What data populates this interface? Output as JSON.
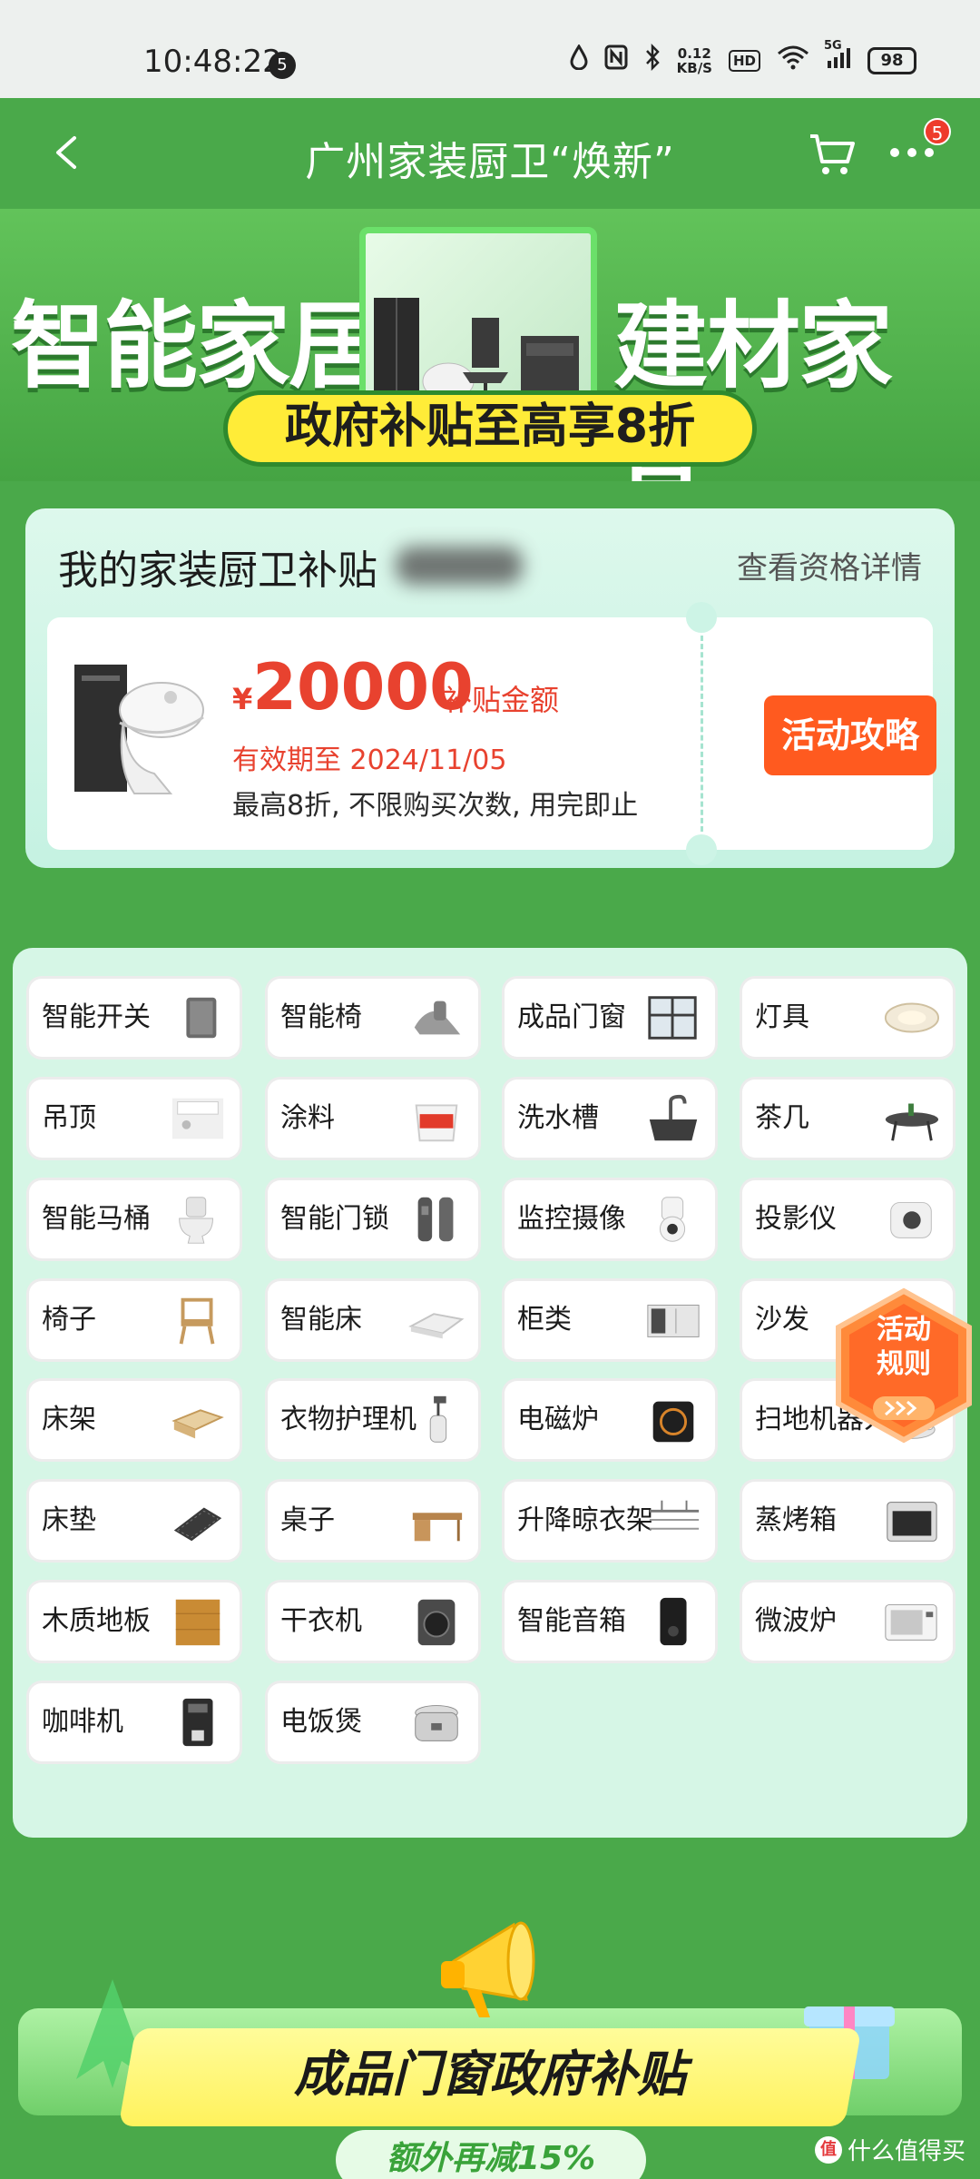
{
  "status_bar": {
    "time": "10:48:22",
    "notification_count": "5",
    "net_speed_value": "0.12",
    "net_speed_unit": "KB/S",
    "hd": "HD",
    "network": "5G",
    "battery": "98"
  },
  "nav": {
    "title": "广州家装厨卫“焕新”",
    "more_badge": "5"
  },
  "banner": {
    "left_text": "智能家居",
    "right_text": "建材家具",
    "pill_text": "政府补贴至高享8折"
  },
  "subsidy": {
    "title": "我的家装厨卫补贴",
    "details_link": "查看资格详情",
    "currency": "¥",
    "amount": "20000",
    "amount_label": "补贴金额",
    "valid_until": "有效期至 2024/11/05",
    "rule": "最高8折, 不限购买次数, 用完即止",
    "button": "活动攻略"
  },
  "categories": [
    {
      "label": "智能开关",
      "icon": "switch-icon"
    },
    {
      "label": "智能椅",
      "icon": "massage-chair-icon"
    },
    {
      "label": "成品门窗",
      "icon": "window-icon"
    },
    {
      "label": "灯具",
      "icon": "ceiling-lamp-icon"
    },
    {
      "label": "吊顶",
      "icon": "ceiling-icon"
    },
    {
      "label": "涂料",
      "icon": "paint-bucket-icon"
    },
    {
      "label": "洗水槽",
      "icon": "sink-icon"
    },
    {
      "label": "茶几",
      "icon": "coffee-table-icon"
    },
    {
      "label": "智能马桶",
      "icon": "toilet-icon"
    },
    {
      "label": "智能门锁",
      "icon": "door-lock-icon"
    },
    {
      "label": "监控摄像",
      "icon": "camera-icon"
    },
    {
      "label": "投影仪",
      "icon": "projector-icon"
    },
    {
      "label": "椅子",
      "icon": "chair-icon"
    },
    {
      "label": "智能床",
      "icon": "bed-icon"
    },
    {
      "label": "柜类",
      "icon": "cabinet-icon"
    },
    {
      "label": "沙发",
      "icon": "sofa-icon"
    },
    {
      "label": "床架",
      "icon": "bed-frame-icon"
    },
    {
      "label": "衣物护理机",
      "icon": "garment-steamer-icon"
    },
    {
      "label": "电磁炉",
      "icon": "induction-cooker-icon"
    },
    {
      "label": "扫地机器人",
      "icon": "robot-vacuum-icon"
    },
    {
      "label": "床垫",
      "icon": "mattress-icon"
    },
    {
      "label": "桌子",
      "icon": "desk-icon"
    },
    {
      "label": "升降晾衣架",
      "icon": "drying-rack-icon"
    },
    {
      "label": "蒸烤箱",
      "icon": "steam-oven-icon"
    },
    {
      "label": "木质地板",
      "icon": "wood-floor-icon"
    },
    {
      "label": "干衣机",
      "icon": "dryer-icon"
    },
    {
      "label": "智能音箱",
      "icon": "speaker-icon"
    },
    {
      "label": "微波炉",
      "icon": "microwave-icon"
    },
    {
      "label": "咖啡机",
      "icon": "coffee-machine-icon"
    },
    {
      "label": "电饭煲",
      "icon": "rice-cooker-icon"
    }
  ],
  "rules_badge": "活动规则",
  "promo": {
    "title": "成品门窗政府补贴",
    "subtitle": "额外再减15%"
  },
  "watermark": "什么值得买",
  "watermark_logo": "值",
  "colors": {
    "primary_green": "#4aa94a",
    "accent_orange": "#ff5a1f",
    "price_red": "#e8422f",
    "pill_yellow": "#ffec38"
  }
}
